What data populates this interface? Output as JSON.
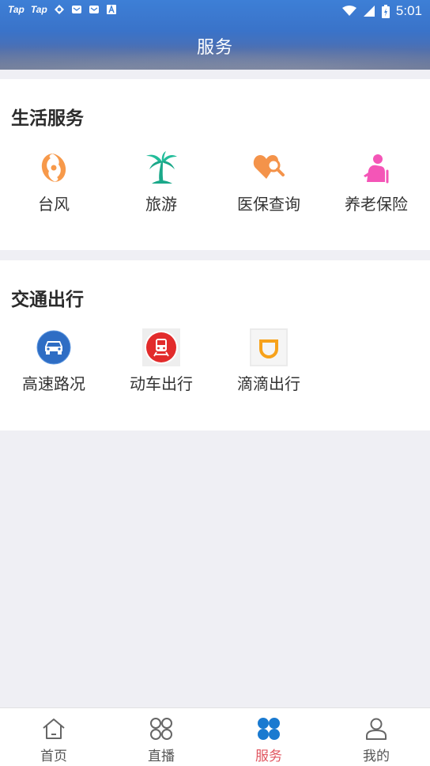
{
  "status_bar": {
    "left_labels": [
      "Tap",
      "Tap"
    ],
    "time": "5:01"
  },
  "header": {
    "title": "服务"
  },
  "sections": [
    {
      "title": "生活服务",
      "items": [
        {
          "label": "台风",
          "icon": "typhoon-icon"
        },
        {
          "label": "旅游",
          "icon": "palm-tree-icon"
        },
        {
          "label": "医保查询",
          "icon": "heart-search-icon"
        },
        {
          "label": "养老保险",
          "icon": "elderly-icon"
        }
      ]
    },
    {
      "title": "交通出行",
      "items": [
        {
          "label": "高速路况",
          "icon": "car-icon"
        },
        {
          "label": "动车出行",
          "icon": "train-icon"
        },
        {
          "label": "滴滴出行",
          "icon": "didi-icon"
        }
      ]
    }
  ],
  "bottom_nav": {
    "items": [
      {
        "label": "首页",
        "icon": "home-icon"
      },
      {
        "label": "直播",
        "icon": "live-grid-icon"
      },
      {
        "label": "服务",
        "icon": "service-icon",
        "active": true
      },
      {
        "label": "我的",
        "icon": "user-icon"
      }
    ],
    "active_color": "#e0555f",
    "active_icon_color": "#1a7ad0"
  }
}
